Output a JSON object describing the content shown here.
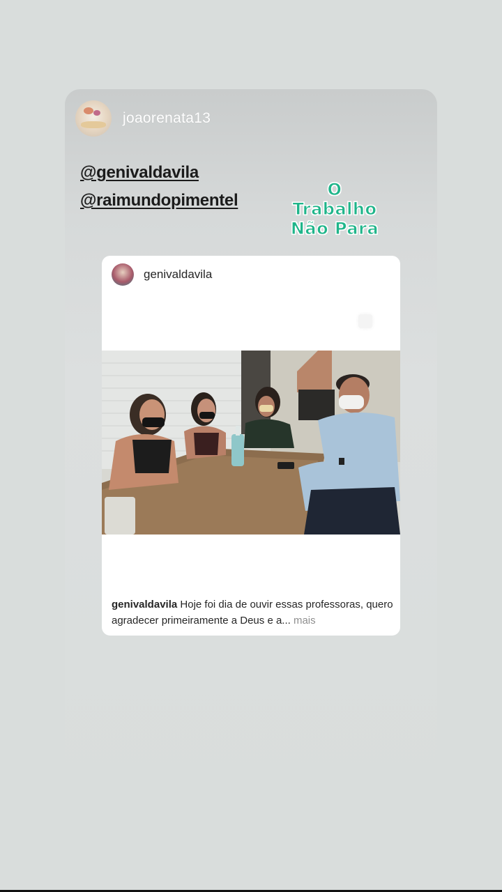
{
  "story": {
    "username": "joaorenata13",
    "mentions": [
      "@genivaldavila",
      "@raimundopimentel"
    ],
    "sticker_lines": [
      "O Trabalho",
      "Não Para"
    ]
  },
  "post": {
    "username": "genivaldavila",
    "caption_user": "genivaldavila",
    "caption_text": "Hoje foi  dia de ouvir essas professoras, quero agradecer primeiramente a Deus e a...",
    "more_label": "mais"
  },
  "colors": {
    "background": "#d9dddc",
    "sticker_green": "#1fb58a",
    "text_dark": "#262626",
    "muted": "#8e8e8e"
  }
}
